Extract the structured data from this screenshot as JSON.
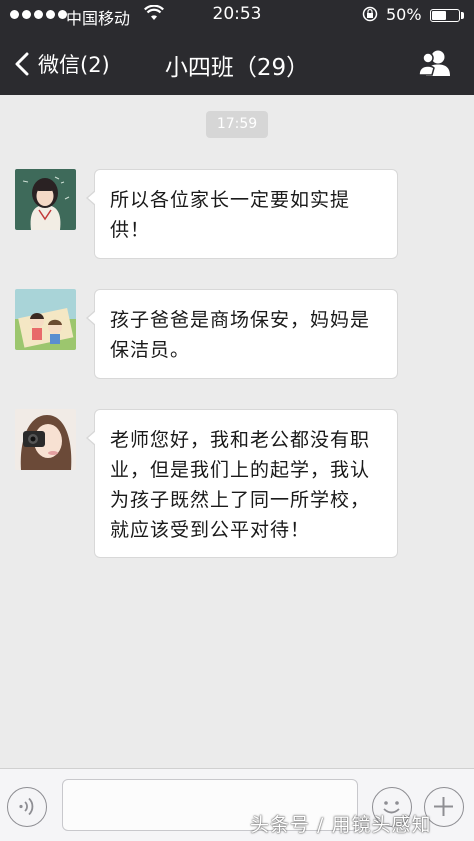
{
  "status_bar": {
    "carrier": "中国移动",
    "time": "20:53",
    "battery_percent": "50%",
    "battery_level": 0.5
  },
  "nav": {
    "back_label": "微信(2)",
    "title": "小四班（29）"
  },
  "chat": {
    "timestamp": "17:59",
    "messages": [
      {
        "avatar": "girl-classroom-avatar",
        "text": "所以各位家长一定要如实提供！"
      },
      {
        "avatar": "cartoon-picnic-avatar",
        "text": "孩子爸爸是商场保安，妈妈是保洁员。"
      },
      {
        "avatar": "girl-camera-avatar",
        "text": "老师您好，我和老公都没有职业，但是我们上的起学，我认为孩子既然上了同一所学校，就应该受到公平对待！"
      }
    ]
  },
  "input_bar": {
    "text_value": "",
    "icons": [
      "voice-icon",
      "emoji-icon",
      "plus-icon"
    ]
  },
  "watermark": "头条号 / 用镜头感知",
  "colors": {
    "header_bg": "#2b2b2f",
    "chat_bg": "#ebebeb",
    "bubble_bg": "#ffffff",
    "timestamp_bg": "#d6d6d6"
  }
}
